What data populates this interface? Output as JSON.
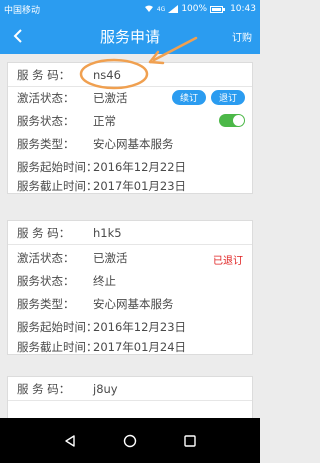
{
  "status_bar": {
    "carrier": "中国移动",
    "network": "4G",
    "battery": "100%",
    "time": "10:43",
    "battery_level": 1.0
  },
  "app_bar": {
    "title": "服务申请",
    "action": "订购"
  },
  "labels": {
    "code": "服 务 码：",
    "activation": "激活状态：",
    "service_status": "服务状态：",
    "service_type": "服务类型：",
    "start_time": "服务起始时间：",
    "end_time": "服务截止时间："
  },
  "cards": [
    {
      "code": "ns46",
      "activation": "已激活",
      "service_status": "正常",
      "service_type": "安心网基本服务",
      "start_time": "2016年12月22日",
      "end_time": "2017年01月23日",
      "renew_label": "续订",
      "unsubscribe_label": "退订",
      "toggle_on": true
    },
    {
      "code": "h1k5",
      "activation": "已激活",
      "service_status": "终止",
      "service_type": "安心网基本服务",
      "start_time": "2016年12月23日",
      "end_time": "2017年01月24日",
      "unsubscribed_label": "已退订"
    },
    {
      "code": "j8uy"
    }
  ],
  "colors": {
    "primary": "#2b9cf0",
    "toggle_on": "#4cb848",
    "danger": "#e02020",
    "annotation": "#f0a050"
  },
  "icons": {
    "back": "chevron-left-icon",
    "nav_back": "triangle-back-icon",
    "nav_home": "circle-home-icon",
    "nav_recent": "square-recent-icon"
  }
}
